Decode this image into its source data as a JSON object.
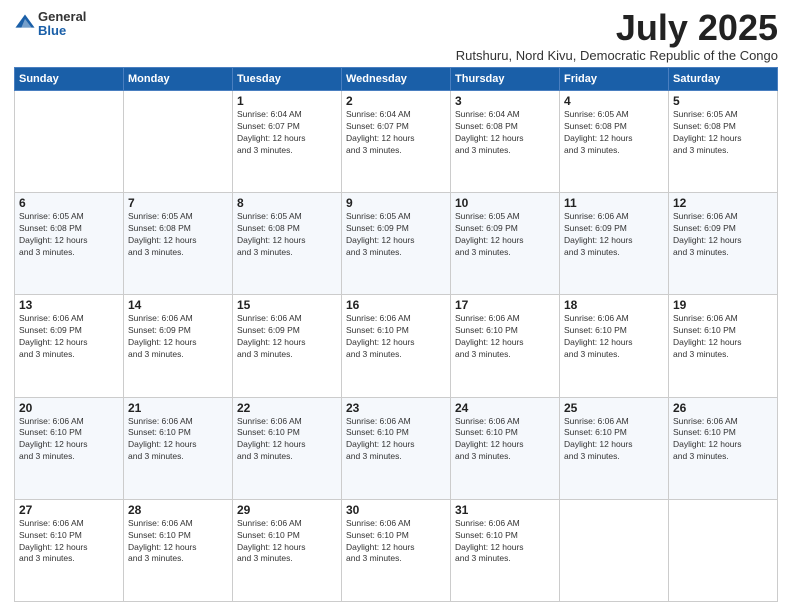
{
  "logo": {
    "general": "General",
    "blue": "Blue"
  },
  "title": "July 2025",
  "location": "Rutshuru, Nord Kivu, Democratic Republic of the Congo",
  "days_of_week": [
    "Sunday",
    "Monday",
    "Tuesday",
    "Wednesday",
    "Thursday",
    "Friday",
    "Saturday"
  ],
  "weeks": [
    [
      {
        "day": "",
        "info": ""
      },
      {
        "day": "",
        "info": ""
      },
      {
        "day": "1",
        "info": "Sunrise: 6:04 AM\nSunset: 6:07 PM\nDaylight: 12 hours\nand 3 minutes."
      },
      {
        "day": "2",
        "info": "Sunrise: 6:04 AM\nSunset: 6:07 PM\nDaylight: 12 hours\nand 3 minutes."
      },
      {
        "day": "3",
        "info": "Sunrise: 6:04 AM\nSunset: 6:08 PM\nDaylight: 12 hours\nand 3 minutes."
      },
      {
        "day": "4",
        "info": "Sunrise: 6:05 AM\nSunset: 6:08 PM\nDaylight: 12 hours\nand 3 minutes."
      },
      {
        "day": "5",
        "info": "Sunrise: 6:05 AM\nSunset: 6:08 PM\nDaylight: 12 hours\nand 3 minutes."
      }
    ],
    [
      {
        "day": "6",
        "info": "Sunrise: 6:05 AM\nSunset: 6:08 PM\nDaylight: 12 hours\nand 3 minutes."
      },
      {
        "day": "7",
        "info": "Sunrise: 6:05 AM\nSunset: 6:08 PM\nDaylight: 12 hours\nand 3 minutes."
      },
      {
        "day": "8",
        "info": "Sunrise: 6:05 AM\nSunset: 6:08 PM\nDaylight: 12 hours\nand 3 minutes."
      },
      {
        "day": "9",
        "info": "Sunrise: 6:05 AM\nSunset: 6:09 PM\nDaylight: 12 hours\nand 3 minutes."
      },
      {
        "day": "10",
        "info": "Sunrise: 6:05 AM\nSunset: 6:09 PM\nDaylight: 12 hours\nand 3 minutes."
      },
      {
        "day": "11",
        "info": "Sunrise: 6:06 AM\nSunset: 6:09 PM\nDaylight: 12 hours\nand 3 minutes."
      },
      {
        "day": "12",
        "info": "Sunrise: 6:06 AM\nSunset: 6:09 PM\nDaylight: 12 hours\nand 3 minutes."
      }
    ],
    [
      {
        "day": "13",
        "info": "Sunrise: 6:06 AM\nSunset: 6:09 PM\nDaylight: 12 hours\nand 3 minutes."
      },
      {
        "day": "14",
        "info": "Sunrise: 6:06 AM\nSunset: 6:09 PM\nDaylight: 12 hours\nand 3 minutes."
      },
      {
        "day": "15",
        "info": "Sunrise: 6:06 AM\nSunset: 6:09 PM\nDaylight: 12 hours\nand 3 minutes."
      },
      {
        "day": "16",
        "info": "Sunrise: 6:06 AM\nSunset: 6:10 PM\nDaylight: 12 hours\nand 3 minutes."
      },
      {
        "day": "17",
        "info": "Sunrise: 6:06 AM\nSunset: 6:10 PM\nDaylight: 12 hours\nand 3 minutes."
      },
      {
        "day": "18",
        "info": "Sunrise: 6:06 AM\nSunset: 6:10 PM\nDaylight: 12 hours\nand 3 minutes."
      },
      {
        "day": "19",
        "info": "Sunrise: 6:06 AM\nSunset: 6:10 PM\nDaylight: 12 hours\nand 3 minutes."
      }
    ],
    [
      {
        "day": "20",
        "info": "Sunrise: 6:06 AM\nSunset: 6:10 PM\nDaylight: 12 hours\nand 3 minutes."
      },
      {
        "day": "21",
        "info": "Sunrise: 6:06 AM\nSunset: 6:10 PM\nDaylight: 12 hours\nand 3 minutes."
      },
      {
        "day": "22",
        "info": "Sunrise: 6:06 AM\nSunset: 6:10 PM\nDaylight: 12 hours\nand 3 minutes."
      },
      {
        "day": "23",
        "info": "Sunrise: 6:06 AM\nSunset: 6:10 PM\nDaylight: 12 hours\nand 3 minutes."
      },
      {
        "day": "24",
        "info": "Sunrise: 6:06 AM\nSunset: 6:10 PM\nDaylight: 12 hours\nand 3 minutes."
      },
      {
        "day": "25",
        "info": "Sunrise: 6:06 AM\nSunset: 6:10 PM\nDaylight: 12 hours\nand 3 minutes."
      },
      {
        "day": "26",
        "info": "Sunrise: 6:06 AM\nSunset: 6:10 PM\nDaylight: 12 hours\nand 3 minutes."
      }
    ],
    [
      {
        "day": "27",
        "info": "Sunrise: 6:06 AM\nSunset: 6:10 PM\nDaylight: 12 hours\nand 3 minutes."
      },
      {
        "day": "28",
        "info": "Sunrise: 6:06 AM\nSunset: 6:10 PM\nDaylight: 12 hours\nand 3 minutes."
      },
      {
        "day": "29",
        "info": "Sunrise: 6:06 AM\nSunset: 6:10 PM\nDaylight: 12 hours\nand 3 minutes."
      },
      {
        "day": "30",
        "info": "Sunrise: 6:06 AM\nSunset: 6:10 PM\nDaylight: 12 hours\nand 3 minutes."
      },
      {
        "day": "31",
        "info": "Sunrise: 6:06 AM\nSunset: 6:10 PM\nDaylight: 12 hours\nand 3 minutes."
      },
      {
        "day": "",
        "info": ""
      },
      {
        "day": "",
        "info": ""
      }
    ]
  ]
}
